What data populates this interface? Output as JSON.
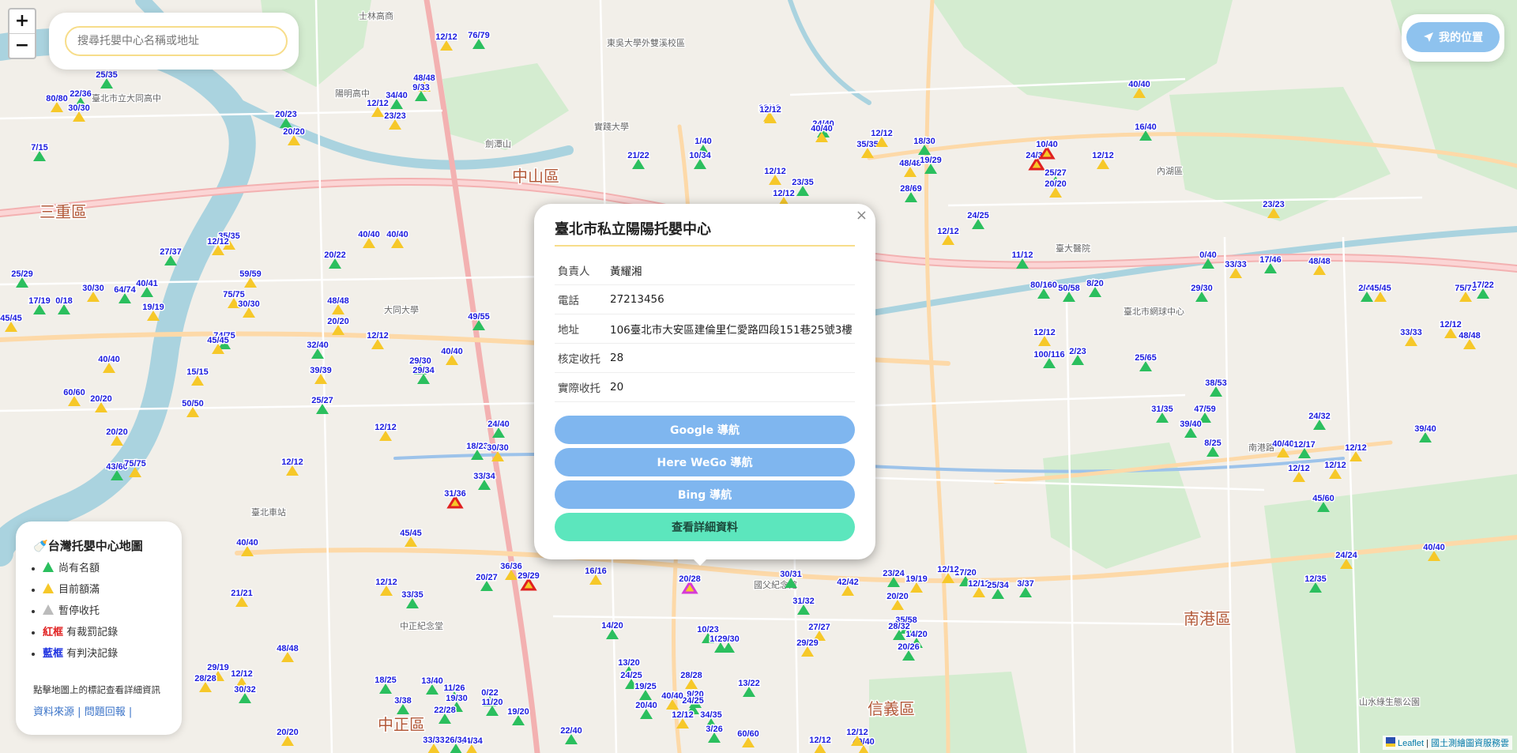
{
  "search": {
    "placeholder": "搜尋托嬰中心名稱或地址"
  },
  "zoom": {
    "in_label": "+",
    "out_label": "−"
  },
  "locate": {
    "label": "我的位置"
  },
  "popup": {
    "close_label": "×",
    "title": "臺北市私立陽陽托嬰中心",
    "rows": [
      {
        "key": "負責人",
        "value": "黃耀湘"
      },
      {
        "key": "電話",
        "value": "27213456"
      },
      {
        "key": "地址",
        "value": "106臺北市大安區建倫里仁愛路四段151巷25號3樓"
      },
      {
        "key": "核定收托",
        "value": "28"
      },
      {
        "key": "實際收托",
        "value": "20"
      }
    ],
    "buttons": {
      "google": "Google 導航",
      "here": "Here WeGo 導航",
      "bing": "Bing 導航",
      "details": "查看詳細資料"
    }
  },
  "legend": {
    "title": "台灣托嬰中心地圖",
    "items": [
      {
        "prefix": "",
        "text": "尚有名額",
        "marker": "#2bbf5e"
      },
      {
        "prefix": "",
        "text": "目前額滿",
        "marker": "#f6c829"
      },
      {
        "prefix": "",
        "text": "暫停收托",
        "marker": "#bbbbbb"
      },
      {
        "prefix": "紅框",
        "text": "有裁罰記錄",
        "prefix_color": "#e02020"
      },
      {
        "prefix": "藍框",
        "text": "有判決記錄",
        "prefix_color": "#1a2ee0"
      }
    ],
    "hint": "點擊地圖上的標記查看詳細資訊",
    "links": {
      "source": "資料來源",
      "sep": "|",
      "report": "問題回報",
      "trail": "|"
    }
  },
  "attribution": {
    "leaflet": "Leaflet",
    "sep": "|",
    "source": "國土測繪圖資服務雲"
  },
  "districts": [
    "三重區",
    "中山區",
    "信義區",
    "中正區",
    "南港區"
  ],
  "places": [
    "士林高商",
    "東吳大學外雙溪校區",
    "陽明高中",
    "實踐大學",
    "劍潭山",
    "大同大學",
    "臺北車站",
    "中正紀念堂",
    "國父紀念館",
    "臺北市網球中心",
    "內湖區",
    "南港路",
    "山水綠生態公園",
    "臺北市立大同高中",
    "臺大醫院"
  ],
  "markers": [
    {
      "label": "12/12",
      "color": "#f6c829"
    },
    {
      "label": "76/79",
      "color": "#2bbf5e"
    },
    {
      "label": "25/35",
      "color": "#2bbf5e"
    },
    {
      "label": "22/36",
      "color": "#2bbf5e"
    },
    {
      "label": "80/80",
      "color": "#f6c829"
    },
    {
      "label": "30/30",
      "color": "#f6c829"
    },
    {
      "label": "34/40",
      "color": "#2bbf5e"
    },
    {
      "label": "48/48",
      "color": "#f6c829"
    },
    {
      "label": "9/33",
      "color": "#2bbf5e"
    },
    {
      "label": "12/12",
      "color": "#f6c829"
    },
    {
      "label": "23/23",
      "color": "#f6c829"
    },
    {
      "label": "20/23",
      "color": "#2bbf5e"
    },
    {
      "label": "20/20",
      "color": "#f6c829"
    },
    {
      "label": "7/15",
      "color": "#2bbf5e"
    },
    {
      "label": "12/12",
      "color": "#f6c829"
    },
    {
      "label": "21/22",
      "color": "#2bbf5e"
    },
    {
      "label": "1/40",
      "color": "#2bbf5e"
    },
    {
      "label": "10/34",
      "color": "#2bbf5e"
    },
    {
      "label": "12/12",
      "color": "#f6c829"
    },
    {
      "label": "24/40",
      "color": "#2bbf5e"
    },
    {
      "label": "40/40",
      "color": "#f6c829"
    },
    {
      "label": "35/35",
      "color": "#f6c829"
    },
    {
      "label": "12/12",
      "color": "#f6c829"
    },
    {
      "label": "18/30",
      "color": "#2bbf5e"
    },
    {
      "label": "48/48",
      "color": "#f6c829"
    },
    {
      "label": "19/29",
      "color": "#2bbf5e"
    },
    {
      "label": "28/69",
      "color": "#2bbf5e"
    },
    {
      "label": "24/38",
      "color": "#e02020"
    },
    {
      "label": "10/40",
      "color": "#e02020"
    },
    {
      "label": "12/12",
      "color": "#f6c829"
    },
    {
      "label": "25/27",
      "color": "#2bbf5e"
    },
    {
      "label": "20/20",
      "color": "#f6c829"
    },
    {
      "label": "16/40",
      "color": "#2bbf5e"
    },
    {
      "label": "40/40",
      "color": "#f6c829"
    },
    {
      "label": "23/23",
      "color": "#f6c829"
    },
    {
      "label": "12/12",
      "color": "#f6c829"
    },
    {
      "label": "23/35",
      "color": "#2bbf5e"
    },
    {
      "label": "12/12",
      "color": "#f6c829"
    },
    {
      "label": "24/25",
      "color": "#2bbf5e"
    },
    {
      "label": "12/12",
      "color": "#f6c829"
    },
    {
      "label": "35/35",
      "color": "#f6c829"
    },
    {
      "label": "40/40",
      "color": "#f6c829"
    },
    {
      "label": "27/37",
      "color": "#2bbf5e"
    },
    {
      "label": "12/12",
      "color": "#f6c829"
    },
    {
      "label": "40/40",
      "color": "#f6c829"
    },
    {
      "label": "20/22",
      "color": "#2bbf5e"
    },
    {
      "label": "59/59",
      "color": "#f6c829"
    },
    {
      "label": "25/29",
      "color": "#2bbf5e"
    },
    {
      "label": "30/30",
      "color": "#f6c829"
    },
    {
      "label": "64/74",
      "color": "#2bbf5e"
    },
    {
      "label": "40/41",
      "color": "#2bbf5e"
    },
    {
      "label": "75/75",
      "color": "#f6c829"
    },
    {
      "label": "17/19",
      "color": "#2bbf5e"
    },
    {
      "label": "0/18",
      "color": "#2bbf5e"
    },
    {
      "label": "45/45",
      "color": "#f6c829"
    },
    {
      "label": "19/19",
      "color": "#f6c829"
    },
    {
      "label": "30/30",
      "color": "#f6c829"
    },
    {
      "label": "48/48",
      "color": "#f6c829"
    },
    {
      "label": "20/20",
      "color": "#f6c829"
    },
    {
      "label": "49/55",
      "color": "#2bbf5e"
    },
    {
      "label": "74/75",
      "color": "#2bbf5e"
    },
    {
      "label": "45/45",
      "color": "#f6c829"
    },
    {
      "label": "32/40",
      "color": "#2bbf5e"
    },
    {
      "label": "12/12",
      "color": "#f6c829"
    },
    {
      "label": "29/30",
      "color": "#2bbf5e"
    },
    {
      "label": "29/34",
      "color": "#2bbf5e"
    },
    {
      "label": "40/40",
      "color": "#f6c829"
    },
    {
      "label": "39/39",
      "color": "#f6c829"
    },
    {
      "label": "40/40",
      "color": "#f6c829"
    },
    {
      "label": "15/15",
      "color": "#f6c829"
    },
    {
      "label": "60/60",
      "color": "#f6c829"
    },
    {
      "label": "20/20",
      "color": "#f6c829"
    },
    {
      "label": "50/50",
      "color": "#f6c829"
    },
    {
      "label": "25/27",
      "color": "#2bbf5e"
    },
    {
      "label": "12/12",
      "color": "#f6c829"
    },
    {
      "label": "24/40",
      "color": "#2bbf5e"
    },
    {
      "label": "18/23",
      "color": "#2bbf5e"
    },
    {
      "label": "30/30",
      "color": "#f6c829"
    },
    {
      "label": "20/20",
      "color": "#f6c829"
    },
    {
      "label": "43/60",
      "color": "#2bbf5e"
    },
    {
      "label": "75/75",
      "color": "#f6c829"
    },
    {
      "label": "12/12",
      "color": "#f6c829"
    },
    {
      "label": "31/36",
      "color": "#e02020"
    },
    {
      "label": "33/34",
      "color": "#2bbf5e"
    },
    {
      "label": "40/40",
      "color": "#f6c829"
    },
    {
      "label": "45/45",
      "color": "#f6c829"
    },
    {
      "label": "12/12",
      "color": "#f6c829"
    },
    {
      "label": "33/35",
      "color": "#2bbf5e"
    },
    {
      "label": "20/27",
      "color": "#2bbf5e"
    },
    {
      "label": "36/36",
      "color": "#f6c829"
    },
    {
      "label": "29/29",
      "color": "#e02020"
    },
    {
      "label": "16/16",
      "color": "#f6c829"
    },
    {
      "label": "20/28",
      "color": "#d63ad6"
    },
    {
      "label": "30/31",
      "color": "#2bbf5e"
    },
    {
      "label": "42/42",
      "color": "#f6c829"
    },
    {
      "label": "23/24",
      "color": "#2bbf5e"
    },
    {
      "label": "19/19",
      "color": "#f6c829"
    },
    {
      "label": "17/20",
      "color": "#2bbf5e"
    },
    {
      "label": "12/12",
      "color": "#f6c829"
    },
    {
      "label": "25/34",
      "color": "#2bbf5e"
    },
    {
      "label": "24/32",
      "color": "#2bbf5e"
    },
    {
      "label": "27/27",
      "color": "#f6c829"
    },
    {
      "label": "29/29",
      "color": "#f6c829"
    },
    {
      "label": "14/20",
      "color": "#2bbf5e"
    },
    {
      "label": "10/23",
      "color": "#2bbf5e"
    },
    {
      "label": "10/25",
      "color": "#2bbf5e"
    },
    {
      "label": "29/30",
      "color": "#2bbf5e"
    },
    {
      "label": "31/32",
      "color": "#2bbf5e"
    },
    {
      "label": "20/20",
      "color": "#f6c829"
    },
    {
      "label": "35/58",
      "color": "#2bbf5e"
    },
    {
      "label": "28/32",
      "color": "#2bbf5e"
    },
    {
      "label": "14/20",
      "color": "#2bbf5e"
    },
    {
      "label": "20/26",
      "color": "#2bbf5e"
    },
    {
      "label": "12/12",
      "color": "#f6c829"
    },
    {
      "label": "21/21",
      "color": "#f6c829"
    },
    {
      "label": "29/19",
      "color": "#f6c829"
    },
    {
      "label": "12/12",
      "color": "#f6c829"
    },
    {
      "label": "48/48",
      "color": "#f6c829"
    },
    {
      "label": "28/28",
      "color": "#f6c829"
    },
    {
      "label": "30/32",
      "color": "#2bbf5e"
    },
    {
      "label": "18/25",
      "color": "#2bbf5e"
    },
    {
      "label": "3/38",
      "color": "#2bbf5e"
    },
    {
      "label": "11/26",
      "color": "#2bbf5e"
    },
    {
      "label": "13/40",
      "color": "#2bbf5e"
    },
    {
      "label": "19/30",
      "color": "#2bbf5e"
    },
    {
      "label": "22/28",
      "color": "#2bbf5e"
    },
    {
      "label": "19/20",
      "color": "#2bbf5e"
    },
    {
      "label": "0/22",
      "color": "#2bbf5e"
    },
    {
      "label": "11/20",
      "color": "#2bbf5e"
    },
    {
      "label": "13/20",
      "color": "#2bbf5e"
    },
    {
      "label": "24/25",
      "color": "#2bbf5e"
    },
    {
      "label": "19/25",
      "color": "#2bbf5e"
    },
    {
      "label": "28/28",
      "color": "#f6c829"
    },
    {
      "label": "9/20",
      "color": "#2bbf5e"
    },
    {
      "label": "24/25",
      "color": "#2bbf5e"
    },
    {
      "label": "40/40",
      "color": "#f6c829"
    },
    {
      "label": "20/40",
      "color": "#2bbf5e"
    },
    {
      "label": "13/22",
      "color": "#2bbf5e"
    },
    {
      "label": "12/12",
      "color": "#f6c829"
    },
    {
      "label": "34/35",
      "color": "#2bbf5e"
    },
    {
      "label": "60/60",
      "color": "#f6c829"
    },
    {
      "label": "12/12",
      "color": "#f6c829"
    },
    {
      "label": "40/40",
      "color": "#f6c829"
    },
    {
      "label": "34/34",
      "color": "#f6c829"
    },
    {
      "label": "33/33",
      "color": "#f6c829"
    },
    {
      "label": "26/34",
      "color": "#2bbf5e"
    },
    {
      "label": "22/40",
      "color": "#2bbf5e"
    },
    {
      "label": "3/26",
      "color": "#2bbf5e"
    },
    {
      "label": "12/12",
      "color": "#f6c829"
    },
    {
      "label": "20/20",
      "color": "#f6c829"
    },
    {
      "label": "3/37",
      "color": "#2bbf5e"
    },
    {
      "label": "11/12",
      "color": "#2bbf5e"
    },
    {
      "label": "80/160",
      "color": "#2bbf5e"
    },
    {
      "label": "50/58",
      "color": "#2bbf5e"
    },
    {
      "label": "8/20",
      "color": "#2bbf5e"
    },
    {
      "label": "29/30",
      "color": "#2bbf5e"
    },
    {
      "label": "0/40",
      "color": "#2bbf5e"
    },
    {
      "label": "33/33",
      "color": "#f6c829"
    },
    {
      "label": "17/46",
      "color": "#2bbf5e"
    },
    {
      "label": "48/48",
      "color": "#f6c829"
    },
    {
      "label": "2/40",
      "color": "#2bbf5e"
    },
    {
      "label": "45/45",
      "color": "#f6c829"
    },
    {
      "label": "75/75",
      "color": "#f6c829"
    },
    {
      "label": "17/22",
      "color": "#2bbf5e"
    },
    {
      "label": "33/33",
      "color": "#f6c829"
    },
    {
      "label": "48/48",
      "color": "#f6c829"
    },
    {
      "label": "12/12",
      "color": "#f6c829"
    },
    {
      "label": "12/12",
      "color": "#f6c829"
    },
    {
      "label": "100/116",
      "color": "#2bbf5e"
    },
    {
      "label": "2/23",
      "color": "#2bbf5e"
    },
    {
      "label": "25/65",
      "color": "#2bbf5e"
    },
    {
      "label": "38/53",
      "color": "#2bbf5e"
    },
    {
      "label": "31/35",
      "color": "#2bbf5e"
    },
    {
      "label": "47/59",
      "color": "#2bbf5e"
    },
    {
      "label": "39/40",
      "color": "#2bbf5e"
    },
    {
      "label": "8/25",
      "color": "#2bbf5e"
    },
    {
      "label": "40/40",
      "color": "#f6c829"
    },
    {
      "label": "12/17",
      "color": "#2bbf5e"
    },
    {
      "label": "12/12",
      "color": "#f6c829"
    },
    {
      "label": "12/12",
      "color": "#f6c829"
    },
    {
      "label": "45/60",
      "color": "#2bbf5e"
    },
    {
      "label": "39/40",
      "color": "#2bbf5e"
    },
    {
      "label": "12/12",
      "color": "#f6c829"
    },
    {
      "label": "40/40",
      "color": "#f6c829"
    },
    {
      "label": "24/24",
      "color": "#f6c829"
    },
    {
      "label": "12/35",
      "color": "#2bbf5e"
    }
  ]
}
